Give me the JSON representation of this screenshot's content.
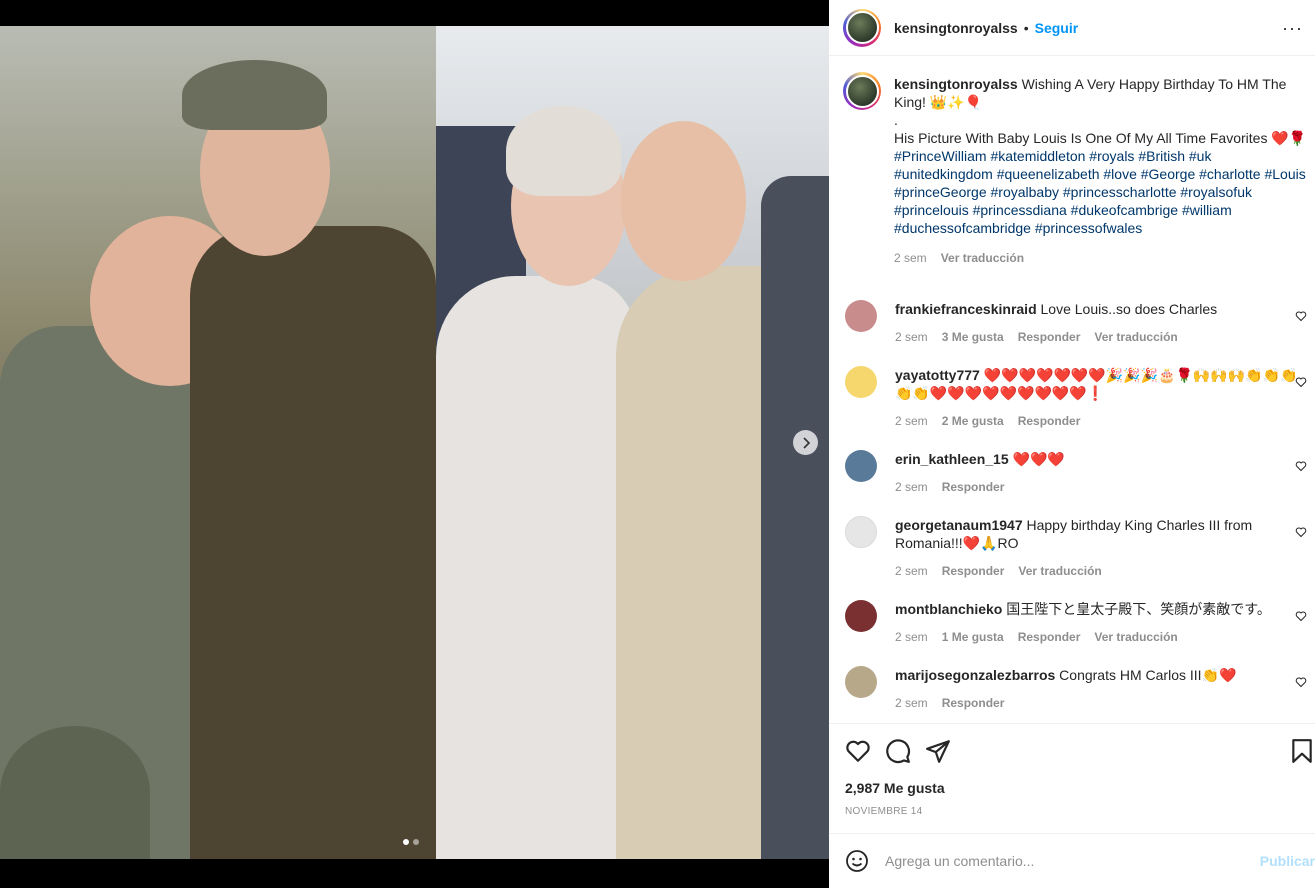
{
  "post": {
    "username": "kensingtonroyalss",
    "follow_label": "Seguir",
    "separator": "•",
    "more_label": "···"
  },
  "caption": {
    "username": "kensingtonroyalss",
    "line1": "Wishing A Very Happy Birthday To HM The King! 👑✨🎈",
    "line2": ".",
    "line3": "His Picture With Baby Louis Is One Of My All Time Favorites ❤️🌹",
    "hashtags": "#PrinceWilliam #katemiddleton #royals #British #uk #unitedkingdom #queenelizabeth #love #George #charlotte #Louis #princeGeorge #royalbaby #princesscharlotte #royalsofuk #princelouis #princessdiana #dukeofcambrige #william #duchessofcambridge #princessofwales",
    "time": "2 sem",
    "translate": "Ver traducción"
  },
  "comments": [
    {
      "username": "frankiefranceskinraid",
      "text": "Love Louis..so does Charles",
      "time": "2 sem",
      "likes": "3 Me gusta",
      "reply": "Responder",
      "translate": "Ver traducción",
      "avatar_color": "#c98c8c"
    },
    {
      "username": "yayatotty777",
      "text": "❤️❤️❤️❤️❤️❤️❤️🎉🎉🎉🎂🌹🙌🙌🙌👏👏👏👏👏❤️❤️❤️❤️❤️❤️❤️❤️❤️❗",
      "time": "2 sem",
      "likes": "2 Me gusta",
      "reply": "Responder",
      "avatar_color": "#f5d76e"
    },
    {
      "username": "erin_kathleen_15",
      "text": "❤️❤️❤️",
      "time": "2 sem",
      "reply": "Responder",
      "avatar_color": "#5a7a9a"
    },
    {
      "username": "georgetanaum1947",
      "text": "Happy birthday King Charles III from Romania!!!❤️🙏RO",
      "time": "2 sem",
      "reply": "Responder",
      "translate": "Ver traducción",
      "avatar_color": "#dbdbdb"
    },
    {
      "username": "montblanchieko",
      "text": "国王陛下と皇太子殿下、笑顔が素敵です。",
      "time": "2 sem",
      "likes": "1 Me gusta",
      "reply": "Responder",
      "translate": "Ver traducción",
      "avatar_color": "#7a3030"
    },
    {
      "username": "marijosegonzalezbarros",
      "text": "Congrats HM Carlos III👏❤️",
      "time": "2 sem",
      "reply": "Responder",
      "avatar_color": "#b8a88a"
    }
  ],
  "stats": {
    "likes": "2,987 Me gusta",
    "date": "NOVIEMBRE 14"
  },
  "composer": {
    "placeholder": "Agrega un comentario...",
    "publish_label": "Publicar"
  },
  "colors": {
    "link_blue": "#0095f6",
    "hashtag": "#00376b",
    "muted": "#8e8e8e"
  },
  "icons": [
    "heart-icon",
    "comment-icon",
    "share-icon",
    "bookmark-icon",
    "emoji-icon",
    "chevron-right-icon"
  ],
  "carousel": {
    "slides": 2,
    "active_index": 0
  }
}
